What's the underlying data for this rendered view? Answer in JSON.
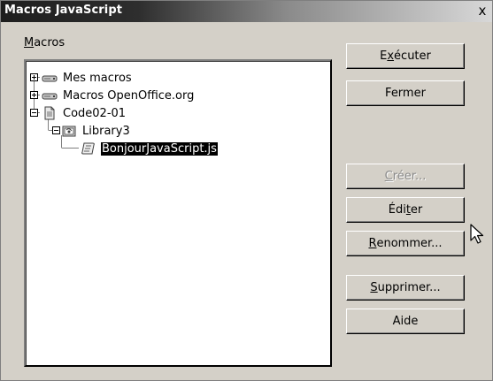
{
  "window": {
    "title": "Macros JavaScript",
    "close_glyph": "x"
  },
  "macros_label": {
    "mnemonic": "M",
    "rest": "acros"
  },
  "tree": {
    "items": [
      {
        "label": "Mes macros",
        "expander": "plus",
        "icon": "drive-icon",
        "level": 0
      },
      {
        "label": "Macros OpenOffice.org",
        "expander": "plus",
        "icon": "drive-icon",
        "level": 0
      },
      {
        "label": "Code02-01",
        "expander": "minus",
        "icon": "document-icon",
        "level": 0
      },
      {
        "label": "Library3",
        "expander": "minus",
        "icon": "library-icon",
        "level": 1
      },
      {
        "label": "BonjourJavaScript.js",
        "expander": "none",
        "icon": "script-icon",
        "level": 2,
        "selected": true
      }
    ]
  },
  "buttons": {
    "execute": {
      "pre": "E",
      "mnemonic": "x",
      "post": "écuter",
      "enabled": true
    },
    "close": {
      "pre": "",
      "mnemonic": "",
      "post": "Fermer",
      "enabled": true
    },
    "create": {
      "pre": "",
      "mnemonic": "C",
      "post": "réer...",
      "enabled": false
    },
    "edit": {
      "pre": "Édi",
      "mnemonic": "t",
      "post": "er",
      "enabled": true
    },
    "rename": {
      "pre": "",
      "mnemonic": "R",
      "post": "enommer...",
      "enabled": true
    },
    "delete": {
      "pre": "",
      "mnemonic": "S",
      "post": "upprimer...",
      "enabled": true
    },
    "help": {
      "pre": "",
      "mnemonic": "",
      "post": "Aide",
      "enabled": true
    }
  },
  "colors": {
    "dialog_bg": "#d4d0c8",
    "selection_bg": "#000000",
    "selection_fg": "#ffffff",
    "disabled_text": "#8a8a8a"
  }
}
